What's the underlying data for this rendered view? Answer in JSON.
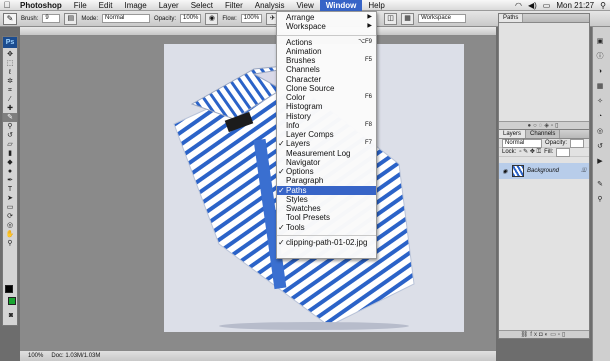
{
  "menubar": {
    "app": "Photoshop",
    "items": [
      "File",
      "Edit",
      "Image",
      "Layer",
      "Select",
      "Filter",
      "Analysis",
      "View",
      "Window",
      "Help"
    ],
    "active": "Window",
    "clock": "Mon 21:27"
  },
  "options_bar": {
    "brush_label": "Brush:",
    "brush_size": "9",
    "mode_label": "Mode:",
    "mode_value": "Normal",
    "opacity_label": "Opacity:",
    "opacity_value": "100%",
    "flow_label": "Flow:",
    "flow_value": "100%",
    "workspace_label": "Workspace"
  },
  "window_menu": {
    "items": [
      {
        "label": "Arrange",
        "shortcut": "▶",
        "checked": false,
        "highlight": false
      },
      {
        "label": "Workspace",
        "shortcut": "▶",
        "checked": false,
        "highlight": false
      },
      {
        "separator": true
      },
      {
        "label": "Actions",
        "shortcut": "⌥F9",
        "checked": false,
        "highlight": false
      },
      {
        "label": "Animation",
        "shortcut": "",
        "checked": false,
        "highlight": false
      },
      {
        "label": "Brushes",
        "shortcut": "F5",
        "checked": false,
        "highlight": false
      },
      {
        "label": "Channels",
        "shortcut": "",
        "checked": false,
        "highlight": false
      },
      {
        "label": "Character",
        "shortcut": "",
        "checked": false,
        "highlight": false
      },
      {
        "label": "Clone Source",
        "shortcut": "",
        "checked": false,
        "highlight": false
      },
      {
        "label": "Color",
        "shortcut": "F6",
        "checked": false,
        "highlight": false
      },
      {
        "label": "Histogram",
        "shortcut": "",
        "checked": false,
        "highlight": false
      },
      {
        "label": "History",
        "shortcut": "",
        "checked": false,
        "highlight": false
      },
      {
        "label": "Info",
        "shortcut": "F8",
        "checked": false,
        "highlight": false
      },
      {
        "label": "Layer Comps",
        "shortcut": "",
        "checked": false,
        "highlight": false
      },
      {
        "label": "Layers",
        "shortcut": "F7",
        "checked": true,
        "highlight": false
      },
      {
        "label": "Measurement Log",
        "shortcut": "",
        "checked": false,
        "highlight": false
      },
      {
        "label": "Navigator",
        "shortcut": "",
        "checked": false,
        "highlight": false
      },
      {
        "label": "Options",
        "shortcut": "",
        "checked": true,
        "highlight": false
      },
      {
        "label": "Paragraph",
        "shortcut": "",
        "checked": false,
        "highlight": false
      },
      {
        "label": "Paths",
        "shortcut": "",
        "checked": true,
        "highlight": true
      },
      {
        "label": "Styles",
        "shortcut": "",
        "checked": false,
        "highlight": false
      },
      {
        "label": "Swatches",
        "shortcut": "",
        "checked": false,
        "highlight": false
      },
      {
        "label": "Tool Presets",
        "shortcut": "",
        "checked": false,
        "highlight": false
      },
      {
        "label": "Tools",
        "shortcut": "",
        "checked": true,
        "highlight": false
      },
      {
        "separator": true
      },
      {
        "label": "clipping-path-01-02.jpg",
        "shortcut": "",
        "checked": true,
        "highlight": false
      }
    ]
  },
  "paths_panel": {
    "tab": "Paths"
  },
  "layers_panel": {
    "tabs": [
      "Layers",
      "Channels"
    ],
    "blend_mode": "Normal",
    "opacity_label": "Opacity:",
    "lock_label": "Lock:",
    "fill_label": "Fill:",
    "layer_name": "Background"
  },
  "status_bar": {
    "zoom": "100%",
    "doc_size": "Doc: 1.03M/1.03M"
  },
  "colors": {
    "menu_highlight": "#3764c7",
    "shirt_stripe": "#2b63c8",
    "foreground_swatch": "#000000",
    "background_swatch": "#1aa531"
  }
}
